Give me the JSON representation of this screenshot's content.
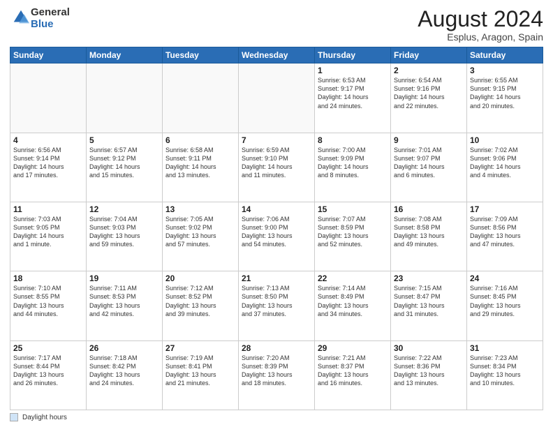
{
  "logo": {
    "general": "General",
    "blue": "Blue"
  },
  "title": "August 2024",
  "subtitle": "Esplus, Aragon, Spain",
  "days_of_week": [
    "Sunday",
    "Monday",
    "Tuesday",
    "Wednesday",
    "Thursday",
    "Friday",
    "Saturday"
  ],
  "footer_label": "Daylight hours",
  "weeks": [
    [
      {
        "day": "",
        "info": ""
      },
      {
        "day": "",
        "info": ""
      },
      {
        "day": "",
        "info": ""
      },
      {
        "day": "",
        "info": ""
      },
      {
        "day": "1",
        "info": "Sunrise: 6:53 AM\nSunset: 9:17 PM\nDaylight: 14 hours\nand 24 minutes."
      },
      {
        "day": "2",
        "info": "Sunrise: 6:54 AM\nSunset: 9:16 PM\nDaylight: 14 hours\nand 22 minutes."
      },
      {
        "day": "3",
        "info": "Sunrise: 6:55 AM\nSunset: 9:15 PM\nDaylight: 14 hours\nand 20 minutes."
      }
    ],
    [
      {
        "day": "4",
        "info": "Sunrise: 6:56 AM\nSunset: 9:14 PM\nDaylight: 14 hours\nand 17 minutes."
      },
      {
        "day": "5",
        "info": "Sunrise: 6:57 AM\nSunset: 9:12 PM\nDaylight: 14 hours\nand 15 minutes."
      },
      {
        "day": "6",
        "info": "Sunrise: 6:58 AM\nSunset: 9:11 PM\nDaylight: 14 hours\nand 13 minutes."
      },
      {
        "day": "7",
        "info": "Sunrise: 6:59 AM\nSunset: 9:10 PM\nDaylight: 14 hours\nand 11 minutes."
      },
      {
        "day": "8",
        "info": "Sunrise: 7:00 AM\nSunset: 9:09 PM\nDaylight: 14 hours\nand 8 minutes."
      },
      {
        "day": "9",
        "info": "Sunrise: 7:01 AM\nSunset: 9:07 PM\nDaylight: 14 hours\nand 6 minutes."
      },
      {
        "day": "10",
        "info": "Sunrise: 7:02 AM\nSunset: 9:06 PM\nDaylight: 14 hours\nand 4 minutes."
      }
    ],
    [
      {
        "day": "11",
        "info": "Sunrise: 7:03 AM\nSunset: 9:05 PM\nDaylight: 14 hours\nand 1 minute."
      },
      {
        "day": "12",
        "info": "Sunrise: 7:04 AM\nSunset: 9:03 PM\nDaylight: 13 hours\nand 59 minutes."
      },
      {
        "day": "13",
        "info": "Sunrise: 7:05 AM\nSunset: 9:02 PM\nDaylight: 13 hours\nand 57 minutes."
      },
      {
        "day": "14",
        "info": "Sunrise: 7:06 AM\nSunset: 9:00 PM\nDaylight: 13 hours\nand 54 minutes."
      },
      {
        "day": "15",
        "info": "Sunrise: 7:07 AM\nSunset: 8:59 PM\nDaylight: 13 hours\nand 52 minutes."
      },
      {
        "day": "16",
        "info": "Sunrise: 7:08 AM\nSunset: 8:58 PM\nDaylight: 13 hours\nand 49 minutes."
      },
      {
        "day": "17",
        "info": "Sunrise: 7:09 AM\nSunset: 8:56 PM\nDaylight: 13 hours\nand 47 minutes."
      }
    ],
    [
      {
        "day": "18",
        "info": "Sunrise: 7:10 AM\nSunset: 8:55 PM\nDaylight: 13 hours\nand 44 minutes."
      },
      {
        "day": "19",
        "info": "Sunrise: 7:11 AM\nSunset: 8:53 PM\nDaylight: 13 hours\nand 42 minutes."
      },
      {
        "day": "20",
        "info": "Sunrise: 7:12 AM\nSunset: 8:52 PM\nDaylight: 13 hours\nand 39 minutes."
      },
      {
        "day": "21",
        "info": "Sunrise: 7:13 AM\nSunset: 8:50 PM\nDaylight: 13 hours\nand 37 minutes."
      },
      {
        "day": "22",
        "info": "Sunrise: 7:14 AM\nSunset: 8:49 PM\nDaylight: 13 hours\nand 34 minutes."
      },
      {
        "day": "23",
        "info": "Sunrise: 7:15 AM\nSunset: 8:47 PM\nDaylight: 13 hours\nand 31 minutes."
      },
      {
        "day": "24",
        "info": "Sunrise: 7:16 AM\nSunset: 8:45 PM\nDaylight: 13 hours\nand 29 minutes."
      }
    ],
    [
      {
        "day": "25",
        "info": "Sunrise: 7:17 AM\nSunset: 8:44 PM\nDaylight: 13 hours\nand 26 minutes."
      },
      {
        "day": "26",
        "info": "Sunrise: 7:18 AM\nSunset: 8:42 PM\nDaylight: 13 hours\nand 24 minutes."
      },
      {
        "day": "27",
        "info": "Sunrise: 7:19 AM\nSunset: 8:41 PM\nDaylight: 13 hours\nand 21 minutes."
      },
      {
        "day": "28",
        "info": "Sunrise: 7:20 AM\nSunset: 8:39 PM\nDaylight: 13 hours\nand 18 minutes."
      },
      {
        "day": "29",
        "info": "Sunrise: 7:21 AM\nSunset: 8:37 PM\nDaylight: 13 hours\nand 16 minutes."
      },
      {
        "day": "30",
        "info": "Sunrise: 7:22 AM\nSunset: 8:36 PM\nDaylight: 13 hours\nand 13 minutes."
      },
      {
        "day": "31",
        "info": "Sunrise: 7:23 AM\nSunset: 8:34 PM\nDaylight: 13 hours\nand 10 minutes."
      }
    ]
  ]
}
